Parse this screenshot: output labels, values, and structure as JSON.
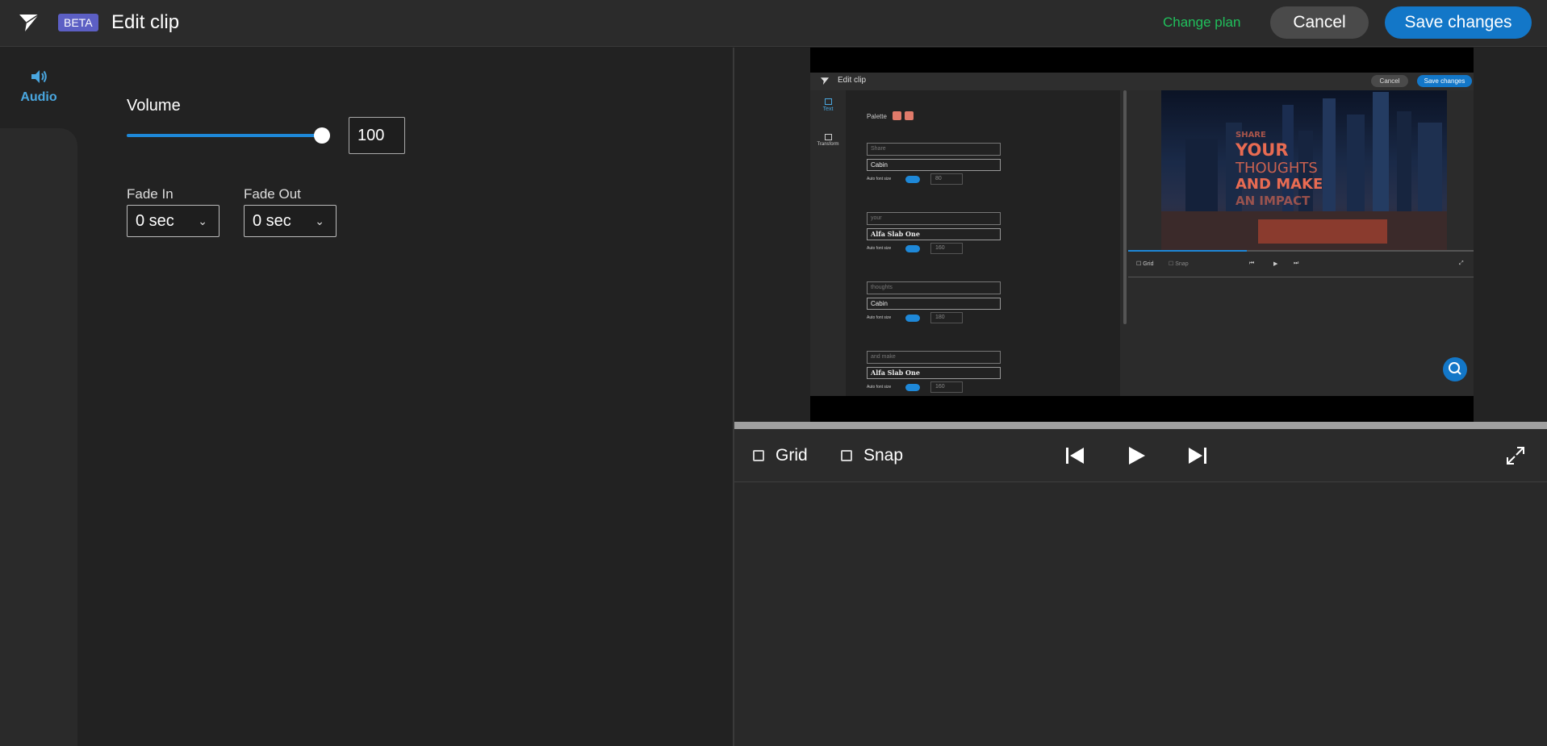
{
  "header": {
    "logo_icon": "paper-plane-logo-icon",
    "beta_badge": "BETA",
    "title": "Edit clip",
    "change_plan_link": "Change plan",
    "cancel_button": "Cancel",
    "save_button": "Save changes",
    "accent_color": "#1377c8",
    "change_plan_color": "#20c05c"
  },
  "sidebar": {
    "tabs": [
      {
        "label": "Audio",
        "icon": "speaker-volume-icon",
        "active": true
      }
    ]
  },
  "audio_settings": {
    "volume_label": "Volume",
    "volume_value": "100",
    "volume_level": 1.0,
    "fade_in_label": "Fade In",
    "fade_in_value": "0 sec",
    "fade_out_label": "Fade Out",
    "fade_out_value": "0 sec"
  },
  "preview": {
    "inner_screenshot": {
      "title": "Edit clip",
      "cancel": "Cancel",
      "save": "Save changes",
      "tab_text": "Text",
      "tab_transform": "Transform",
      "palette_label": "Palette",
      "fields": [
        {
          "placeholder": "Share",
          "font": "Cabin",
          "auto_label": "Auto font size",
          "size": "80"
        },
        {
          "placeholder": "your",
          "font": "Alfa Slab One",
          "auto_label": "Auto font size",
          "size": "160"
        },
        {
          "placeholder": "thoughts",
          "font": "Cabin",
          "auto_label": "Auto font size",
          "size": "180"
        },
        {
          "placeholder": "and make",
          "font": "Alfa Slab One",
          "auto_label": "Auto font size",
          "size": "160"
        }
      ],
      "overlay_lines": [
        "SHARE",
        "YOUR",
        "THOUGHTS",
        "AND MAKE",
        "AN IMPACT"
      ],
      "grid_label": "Grid",
      "snap_label": "Snap"
    }
  },
  "player_controls": {
    "grid_label": "Grid",
    "snap_label": "Snap",
    "grid_checked": false,
    "snap_checked": false,
    "skip_back_icon": "skip-to-start-icon",
    "play_icon": "play-icon",
    "skip_forward_icon": "skip-to-end-icon",
    "fullscreen_icon": "expand-fullscreen-icon"
  }
}
